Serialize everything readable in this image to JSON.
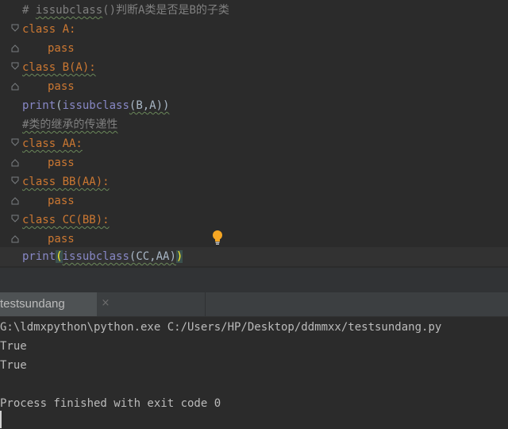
{
  "editor": {
    "comment_text": "# ",
    "comment_func": "issubclass",
    "comment_rest": "()判断A类是否是B的子类",
    "line2": "class A:",
    "line3": "pass",
    "line4": "class B(A):",
    "line5": "pass",
    "line6_print": "print",
    "line6_func": "issubclass",
    "line6_args": "(B,A))",
    "line7": "#类的继承的传递性",
    "line8": "class AA:",
    "line9": "pass",
    "line10": "class BB(AA):",
    "line11": "pass",
    "line12": "class CC(BB):",
    "line13": "pass",
    "line14_print": "print",
    "line14_open": "(",
    "line14_func": "issubclass",
    "line14_args": "(CC,AA)",
    "line14_close": ")"
  },
  "run_panel": {
    "tab_label": "testsundang",
    "close_icon": "×"
  },
  "console": {
    "lines": [
      "G:\\ldmxpython\\python.exe C:/Users/HP/Desktop/ddmmxx/testsundang.py",
      "True",
      "True",
      "",
      "Process finished with exit code 0"
    ]
  },
  "colors": {
    "keyword": "#cc7832",
    "builtin": "#8888c6",
    "comment": "#808080",
    "text": "#a9b7c6"
  }
}
